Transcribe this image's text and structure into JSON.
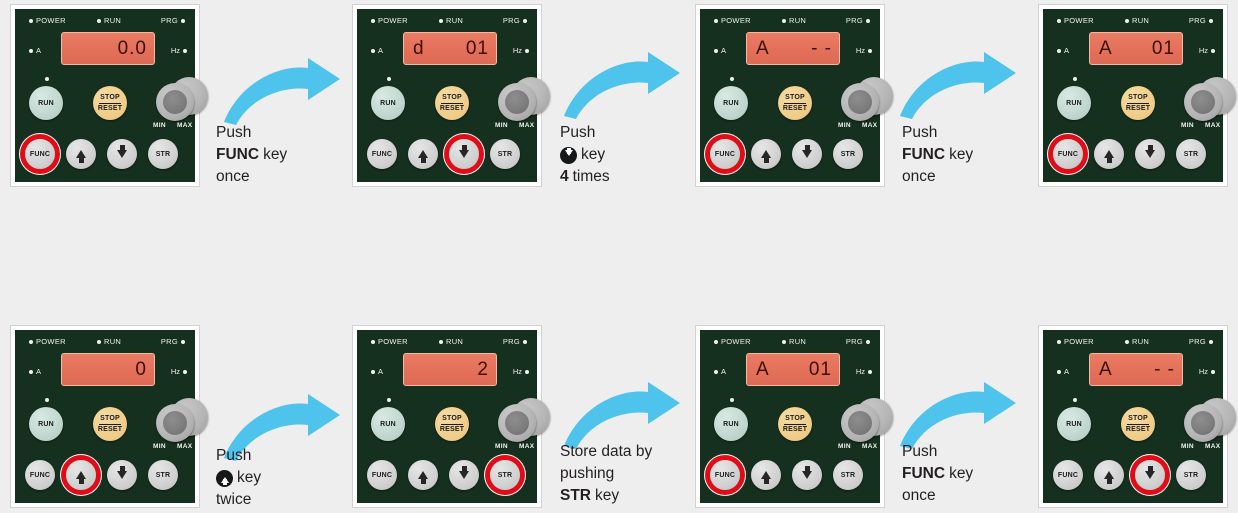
{
  "theme": {
    "background": "#eeeeee",
    "panel_face": "#16301f",
    "display_bg": "#e4705a",
    "display_text": "#3a1108",
    "arrow_blue": "#4ec3ec",
    "highlight_red": "#e00c18",
    "run_button": "#bcd4cc",
    "stop_button": "#efcb86",
    "key_button": "#cfcfcf",
    "knob": "#b4b4b4",
    "led_text": "#f2f2ee"
  },
  "panel_common": {
    "leds": [
      {
        "name": "power",
        "label": "POWER",
        "dot_side": "left"
      },
      {
        "name": "run",
        "label": "RUN",
        "dot_side": "left"
      },
      {
        "name": "prg",
        "label": "PRG",
        "dot_side": "right"
      }
    ],
    "units": [
      {
        "name": "amps",
        "label": "A",
        "dot_side": "left"
      },
      {
        "name": "hertz",
        "label": "Hz",
        "dot_side": "right"
      }
    ],
    "buttons": {
      "run": "RUN",
      "stop_line1": "STOP",
      "stop_line2": "RESET",
      "func": "FUNC",
      "up": "up-arrow",
      "down": "down-arrow",
      "str": "STR"
    },
    "knob": {
      "min_label": "MIN",
      "max_label": "MAX"
    }
  },
  "panels": [
    {
      "id": "panel-1",
      "display_left": "",
      "display_right": "0.0",
      "display_single": true,
      "highlight": "func"
    },
    {
      "id": "panel-2",
      "display_left": "d",
      "display_right": "01",
      "display_single": false,
      "highlight": "down"
    },
    {
      "id": "panel-3",
      "display_left": "A",
      "display_right": "- -",
      "display_single": false,
      "highlight": "func"
    },
    {
      "id": "panel-4",
      "display_left": "A",
      "display_right": "01",
      "display_single": false,
      "highlight": "func"
    },
    {
      "id": "panel-5",
      "display_left": "",
      "display_right": "0",
      "display_single": true,
      "highlight": "up"
    },
    {
      "id": "panel-6",
      "display_left": "",
      "display_right": "2",
      "display_single": true,
      "highlight": "str"
    },
    {
      "id": "panel-7",
      "display_left": "A",
      "display_right": "01",
      "display_single": false,
      "highlight": "func"
    },
    {
      "id": "panel-8",
      "display_left": "A",
      "display_right": "- -",
      "display_single": false,
      "highlight": "down"
    }
  ],
  "steps": [
    {
      "id": "step-1",
      "line1": "Push",
      "line2_bold": "FUNC",
      "line2_rest": "key",
      "line3": "once",
      "glyph": null
    },
    {
      "id": "step-2",
      "line1": "Push",
      "line2_bold": "",
      "line2_rest": "key",
      "line3_bold": "4",
      "line3_rest": "times",
      "glyph": "down"
    },
    {
      "id": "step-3",
      "line1": "Push",
      "line2_bold": "FUNC",
      "line2_rest": "key",
      "line3": "once",
      "glyph": null
    },
    {
      "id": "step-4",
      "line1": "Push",
      "line2_bold": "",
      "line2_rest": "key",
      "line3": "twice",
      "glyph": "up"
    },
    {
      "id": "step-5",
      "line1": "Store data by",
      "line2_rest": "pushing",
      "line3_bold": "STR",
      "line3_rest": "key",
      "glyph": null
    },
    {
      "id": "step-6",
      "line1": "Push",
      "line2_bold": "FUNC",
      "line2_rest": "key",
      "line3": "once",
      "glyph": null
    }
  ]
}
